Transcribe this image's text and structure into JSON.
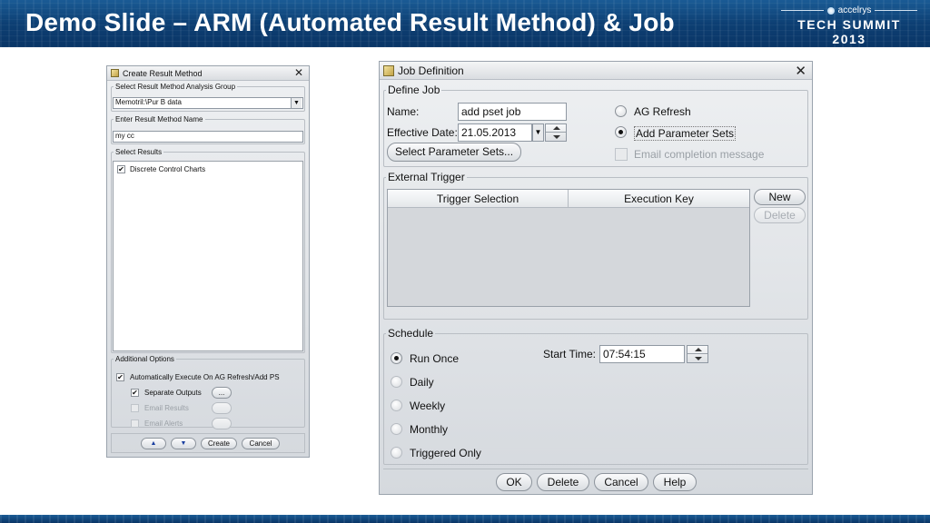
{
  "slide": {
    "title": "Demo Slide – ARM (Automated Result Method) & Job",
    "brand_name": "accelrys",
    "brand_event": "TECH SUMMIT 2013"
  },
  "create_result_method": {
    "title": "Create Result Method",
    "group_legend": "Select Result Method Analysis Group",
    "group_value": "Memotril:\\Pur B data",
    "name_legend": "Enter Result Method Name",
    "name_value": "my cc",
    "results_legend": "Select Results",
    "results": [
      {
        "label": "Discrete Control Charts",
        "checked": true
      }
    ],
    "options_legend": "Additional Options",
    "auto_execute_label": "Automatically Execute On AG Refresh/Add PS",
    "separate_outputs_label": "Separate Outputs",
    "email_results_label": "Email Results",
    "email_alerts_label": "Email Alerts",
    "ellipsis_label": "...",
    "create_label": "Create",
    "cancel_label": "Cancel"
  },
  "job_definition": {
    "title": "Job Definition",
    "define_legend": "Define Job",
    "name_label": "Name:",
    "name_value": "add pset job",
    "date_label": "Effective Date:",
    "date_value": "21.05.2013",
    "select_param_button": "Select Parameter Sets...",
    "ag_refresh_label": "AG Refresh",
    "add_param_sets_label": "Add Parameter Sets",
    "email_completion_label": "Email completion message",
    "trigger_legend": "External Trigger",
    "trigger_columns": [
      "Trigger Selection",
      "Execution Key"
    ],
    "new_button": "New",
    "delete_disabled_button": "Delete",
    "schedule_legend": "Schedule",
    "schedule_options": [
      "Run Once",
      "Daily",
      "Weekly",
      "Monthly",
      "Triggered Only"
    ],
    "schedule_selected": "Run Once",
    "start_time_label": "Start Time:",
    "start_time_value": "07:54:15",
    "ok_button": "OK",
    "delete_button": "Delete",
    "cancel_button": "Cancel",
    "help_button": "Help"
  }
}
